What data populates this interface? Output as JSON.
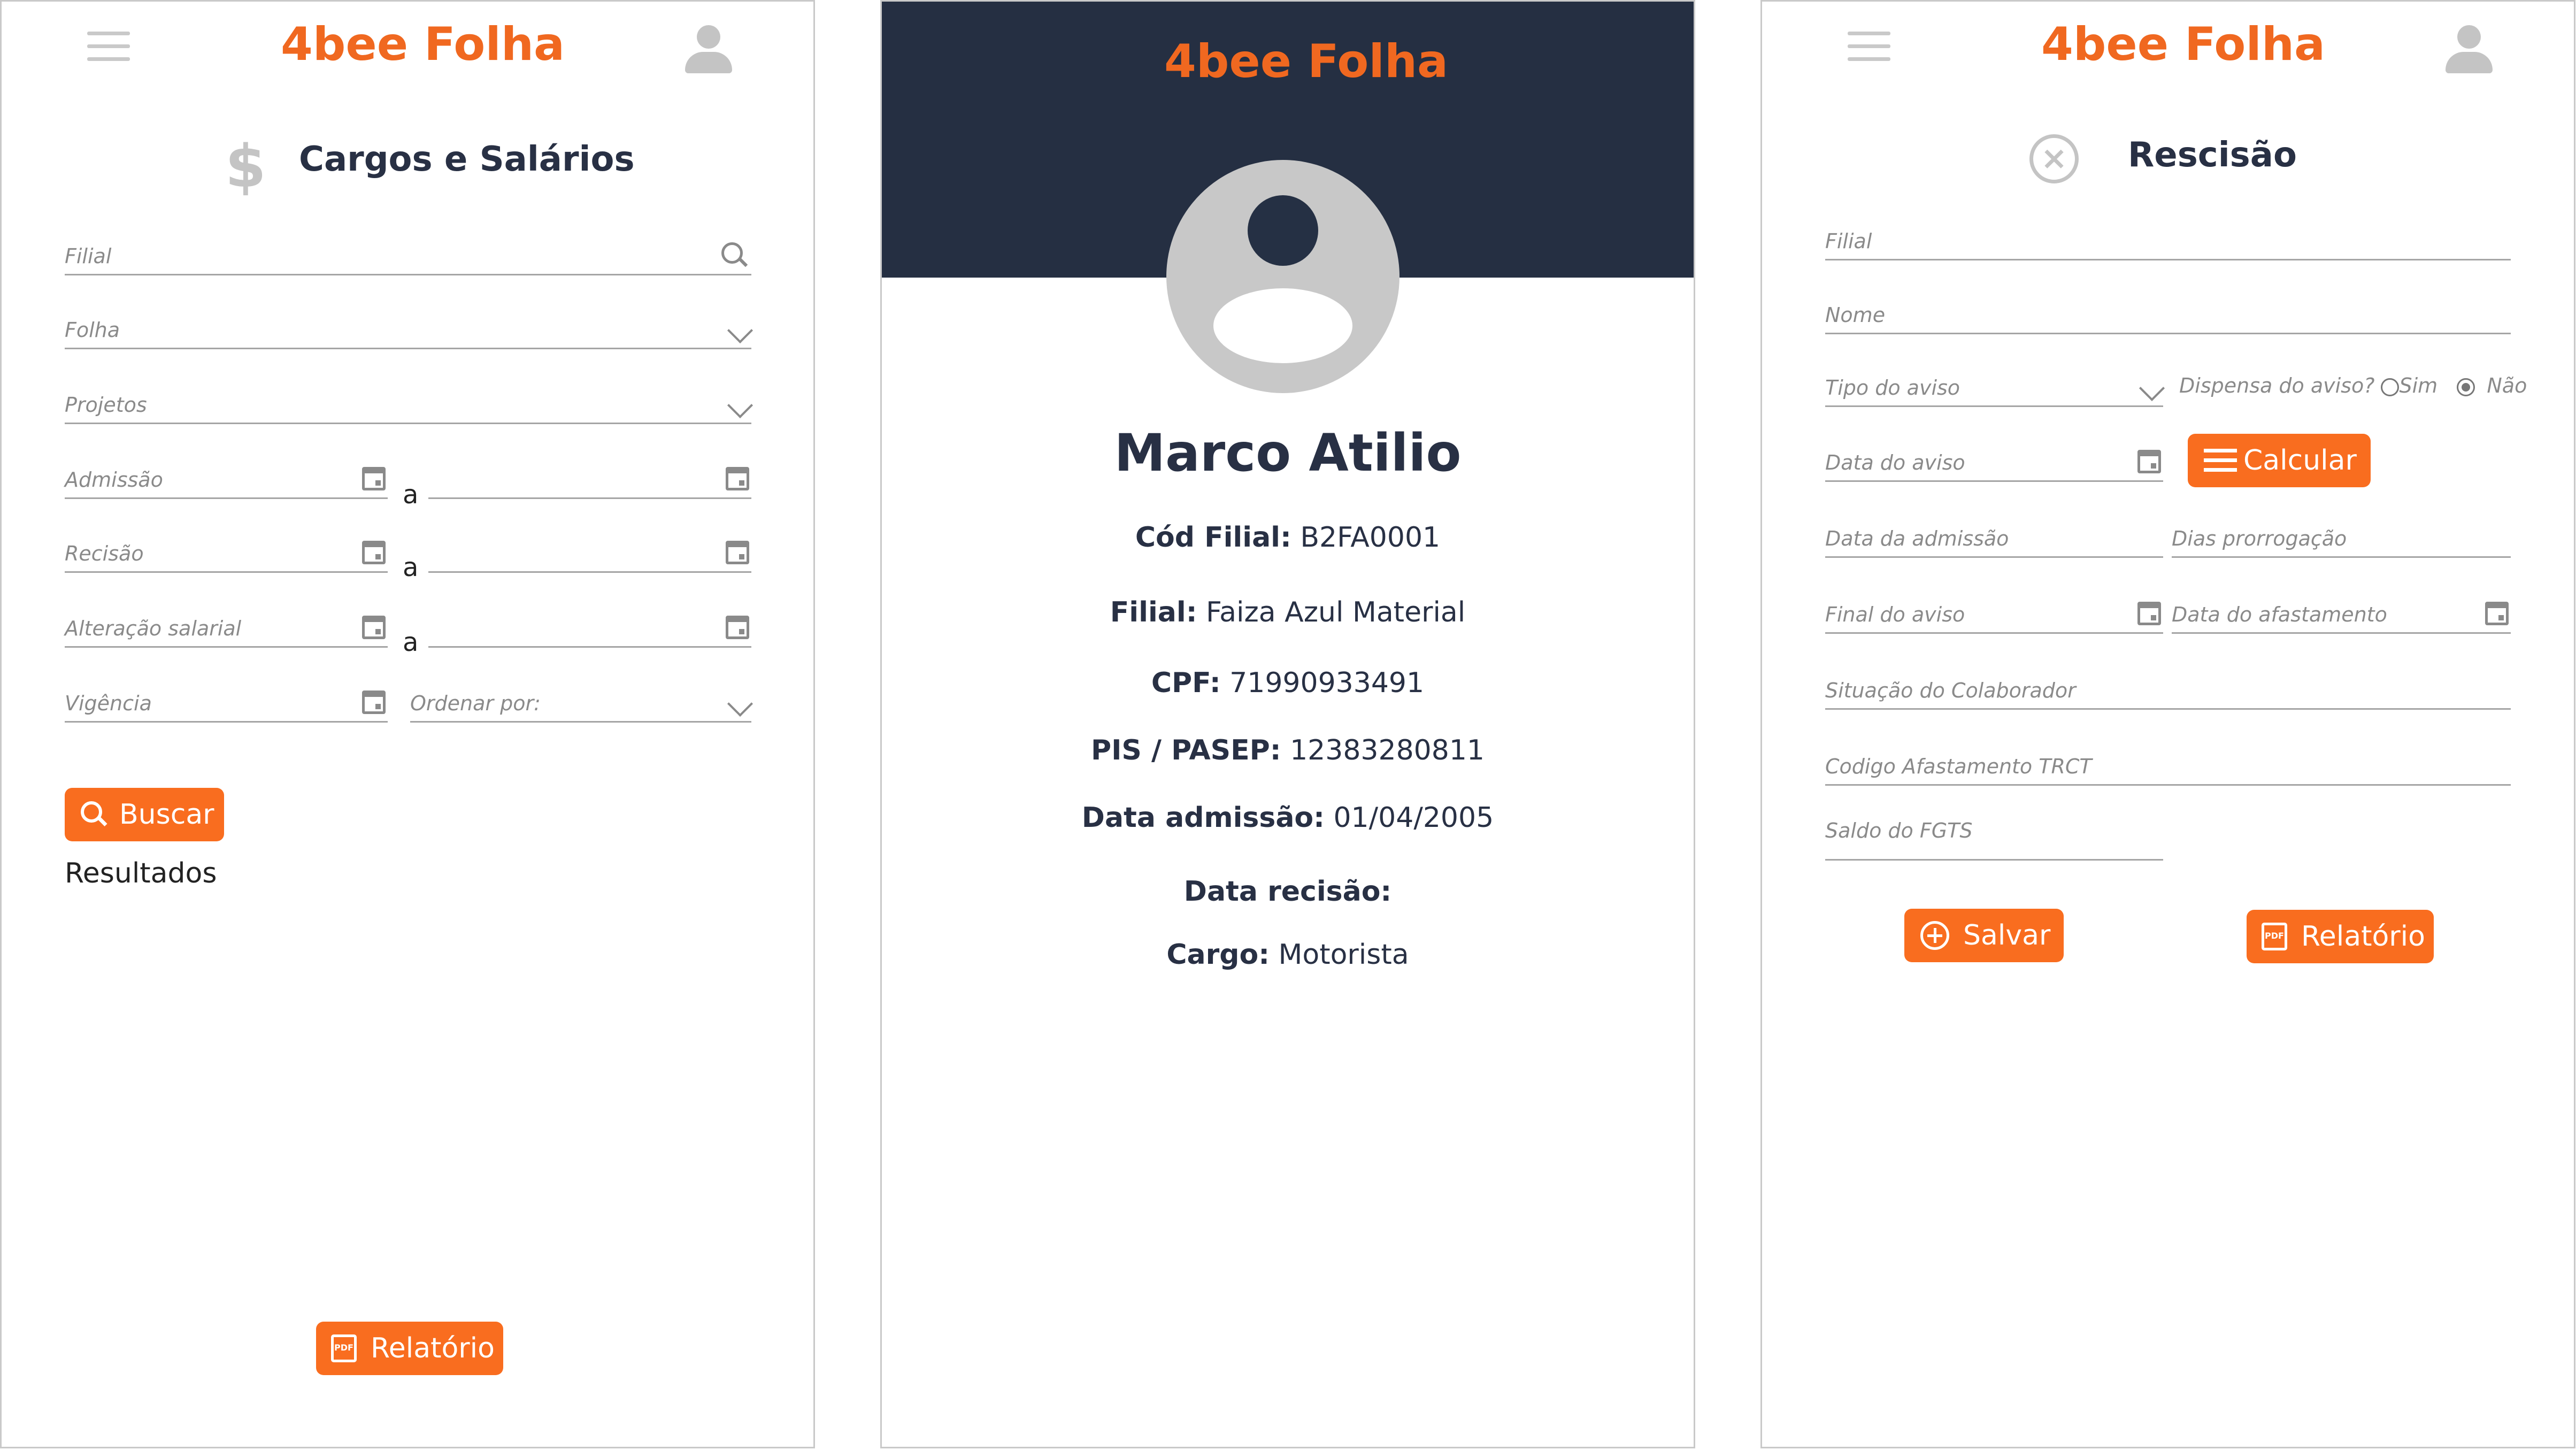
{
  "brand": "4bee Folha",
  "colors": {
    "accent": "#f96d1f",
    "brand": "#f06820",
    "dark": "#252f42",
    "icon": "#c4c4c4"
  },
  "cargos": {
    "title": "Cargos e Salários",
    "title_icon": "dollar-icon",
    "fields": {
      "filial": "Filial",
      "folha": "Folha",
      "projetos": "Projetos",
      "admissao": "Admissão",
      "recisao": "Recisão",
      "alteracao": "Alteração salarial",
      "vigencia": "Vigência",
      "ordenar": "Ordenar por:"
    },
    "range_sep": "a",
    "buscar": "Buscar",
    "resultados": "Resultados",
    "relatorio": "Relatório"
  },
  "profile": {
    "name": "Marco Atilio",
    "rows": [
      {
        "label": "Cód Filial:",
        "value": "B2FA0001"
      },
      {
        "label": "Filial:",
        "value": "Faiza Azul Material"
      },
      {
        "label": "CPF:",
        "value": "71990933491"
      },
      {
        "label": "PIS / PASEP:",
        "value": "12383280811"
      },
      {
        "label": "Data admissão:",
        "value": "01/04/2005"
      },
      {
        "label": "Data recisão:",
        "value": ""
      },
      {
        "label": "Cargo:",
        "value": "Motorista"
      }
    ]
  },
  "rescisao": {
    "title": "Rescisão",
    "title_icon": "close-circle-icon",
    "fields": {
      "filial": "Filial",
      "nome": "Nome",
      "tipo_aviso": "Tipo do aviso",
      "dispensa": "Dispensa do aviso?",
      "sim": "Sim",
      "nao": "Não",
      "data_aviso": "Data do aviso",
      "data_admissao": "Data da admissão",
      "dias_prorrogacao": "Dias prorrogação",
      "final_aviso": "Final do aviso",
      "data_afastamento": "Data do afastamento",
      "situacao": "Situação do Colaborador",
      "codigo_trct": "Codigo Afastamento TRCT",
      "saldo_fgts": "Saldo do FGTS"
    },
    "calcular": "Calcular",
    "salvar": "Salvar",
    "relatorio": "Relatório"
  }
}
